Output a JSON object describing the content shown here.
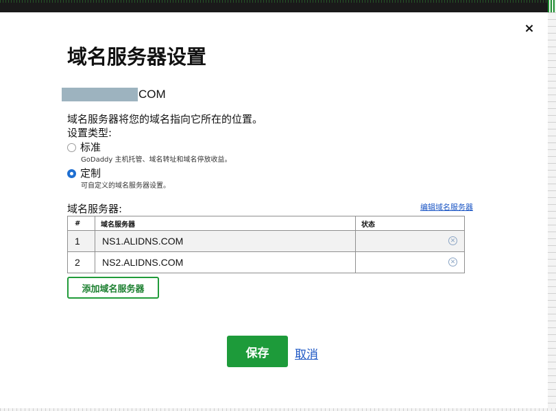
{
  "dialog": {
    "close_label": "×",
    "title": "域名服务器设置",
    "domain_tld": "COM",
    "description": "域名服务器将您的域名指向它所在的位置。",
    "type_label": "设置类型:",
    "options": [
      {
        "label": "标准",
        "sublabel": "GoDaddy 主机托管、域名转址和域名停放收益。",
        "checked": false
      },
      {
        "label": "定制",
        "sublabel": "可自定义的域名服务器设置。",
        "checked": true
      }
    ],
    "nameservers_label": "域名服务器:",
    "edit_link": "编辑域名服务器",
    "table": {
      "headers": [
        "#",
        "域名服务器",
        "状态"
      ],
      "rows": [
        {
          "num": "1",
          "name": "NS1.ALIDNS.COM",
          "status": ""
        },
        {
          "num": "2",
          "name": "NS2.ALIDNS.COM",
          "status": ""
        }
      ]
    },
    "add_button": "添加域名服务器",
    "save_button": "保存",
    "cancel_link": "取消"
  },
  "colors": {
    "primary_green": "#1d9b3a",
    "link_blue": "#1a55c4",
    "radio_checked": "#1f6fd1",
    "redaction": "#9db3bf"
  },
  "icons": {
    "close": "close-icon",
    "remove": "remove-circle-x-icon"
  }
}
